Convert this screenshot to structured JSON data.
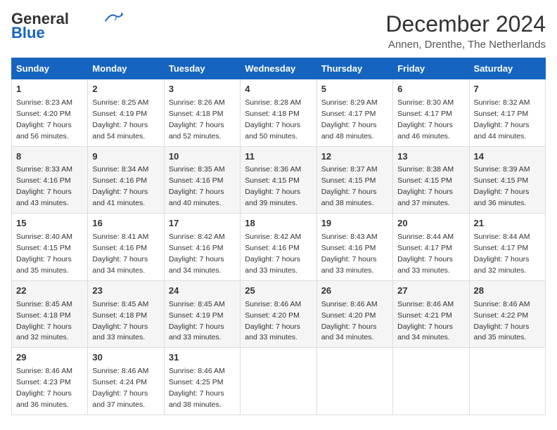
{
  "header": {
    "logo_line1": "General",
    "logo_line2": "Blue",
    "month_title": "December 2024",
    "location": "Annen, Drenthe, The Netherlands"
  },
  "weekdays": [
    "Sunday",
    "Monday",
    "Tuesday",
    "Wednesday",
    "Thursday",
    "Friday",
    "Saturday"
  ],
  "weeks": [
    [
      {
        "day": 1,
        "rise": "8:23 AM",
        "set": "4:20 PM",
        "light": "7 hours and 56 minutes."
      },
      {
        "day": 2,
        "rise": "8:25 AM",
        "set": "4:19 PM",
        "light": "7 hours and 54 minutes."
      },
      {
        "day": 3,
        "rise": "8:26 AM",
        "set": "4:18 PM",
        "light": "7 hours and 52 minutes."
      },
      {
        "day": 4,
        "rise": "8:28 AM",
        "set": "4:18 PM",
        "light": "7 hours and 50 minutes."
      },
      {
        "day": 5,
        "rise": "8:29 AM",
        "set": "4:17 PM",
        "light": "7 hours and 48 minutes."
      },
      {
        "day": 6,
        "rise": "8:30 AM",
        "set": "4:17 PM",
        "light": "7 hours and 46 minutes."
      },
      {
        "day": 7,
        "rise": "8:32 AM",
        "set": "4:17 PM",
        "light": "7 hours and 44 minutes."
      }
    ],
    [
      {
        "day": 8,
        "rise": "8:33 AM",
        "set": "4:16 PM",
        "light": "7 hours and 43 minutes."
      },
      {
        "day": 9,
        "rise": "8:34 AM",
        "set": "4:16 PM",
        "light": "7 hours and 41 minutes."
      },
      {
        "day": 10,
        "rise": "8:35 AM",
        "set": "4:16 PM",
        "light": "7 hours and 40 minutes."
      },
      {
        "day": 11,
        "rise": "8:36 AM",
        "set": "4:15 PM",
        "light": "7 hours and 39 minutes."
      },
      {
        "day": 12,
        "rise": "8:37 AM",
        "set": "4:15 PM",
        "light": "7 hours and 38 minutes."
      },
      {
        "day": 13,
        "rise": "8:38 AM",
        "set": "4:15 PM",
        "light": "7 hours and 37 minutes."
      },
      {
        "day": 14,
        "rise": "8:39 AM",
        "set": "4:15 PM",
        "light": "7 hours and 36 minutes."
      }
    ],
    [
      {
        "day": 15,
        "rise": "8:40 AM",
        "set": "4:15 PM",
        "light": "7 hours and 35 minutes."
      },
      {
        "day": 16,
        "rise": "8:41 AM",
        "set": "4:16 PM",
        "light": "7 hours and 34 minutes."
      },
      {
        "day": 17,
        "rise": "8:42 AM",
        "set": "4:16 PM",
        "light": "7 hours and 34 minutes."
      },
      {
        "day": 18,
        "rise": "8:42 AM",
        "set": "4:16 PM",
        "light": "7 hours and 33 minutes."
      },
      {
        "day": 19,
        "rise": "8:43 AM",
        "set": "4:16 PM",
        "light": "7 hours and 33 minutes."
      },
      {
        "day": 20,
        "rise": "8:44 AM",
        "set": "4:17 PM",
        "light": "7 hours and 33 minutes."
      },
      {
        "day": 21,
        "rise": "8:44 AM",
        "set": "4:17 PM",
        "light": "7 hours and 32 minutes."
      }
    ],
    [
      {
        "day": 22,
        "rise": "8:45 AM",
        "set": "4:18 PM",
        "light": "7 hours and 32 minutes."
      },
      {
        "day": 23,
        "rise": "8:45 AM",
        "set": "4:18 PM",
        "light": "7 hours and 33 minutes."
      },
      {
        "day": 24,
        "rise": "8:45 AM",
        "set": "4:19 PM",
        "light": "7 hours and 33 minutes."
      },
      {
        "day": 25,
        "rise": "8:46 AM",
        "set": "4:20 PM",
        "light": "7 hours and 33 minutes."
      },
      {
        "day": 26,
        "rise": "8:46 AM",
        "set": "4:20 PM",
        "light": "7 hours and 34 minutes."
      },
      {
        "day": 27,
        "rise": "8:46 AM",
        "set": "4:21 PM",
        "light": "7 hours and 34 minutes."
      },
      {
        "day": 28,
        "rise": "8:46 AM",
        "set": "4:22 PM",
        "light": "7 hours and 35 minutes."
      }
    ],
    [
      {
        "day": 29,
        "rise": "8:46 AM",
        "set": "4:23 PM",
        "light": "7 hours and 36 minutes."
      },
      {
        "day": 30,
        "rise": "8:46 AM",
        "set": "4:24 PM",
        "light": "7 hours and 37 minutes."
      },
      {
        "day": 31,
        "rise": "8:46 AM",
        "set": "4:25 PM",
        "light": "7 hours and 38 minutes."
      },
      null,
      null,
      null,
      null
    ]
  ]
}
